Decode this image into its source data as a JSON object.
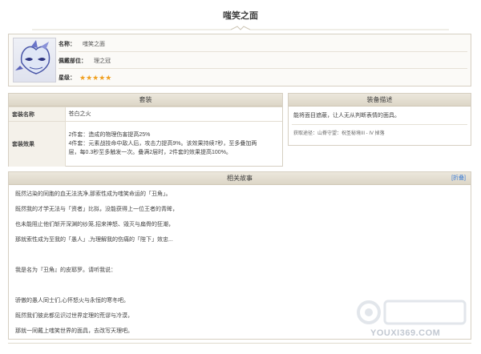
{
  "page": {
    "title": "嗤笑之面"
  },
  "item": {
    "name_label": "名称：",
    "name_value": "嗤笑之面",
    "slot_label": "佩戴部位：",
    "slot_value": "理之冠",
    "rarity_label": "星级：",
    "rarity_stars": "★★★★★",
    "rarity_count": 5,
    "star_color": "#f0a020"
  },
  "set_panel": {
    "title": "套装",
    "rows": [
      {
        "label": "套装名称",
        "lines": [
          "苍白之火"
        ]
      },
      {
        "label": "套装效果",
        "lines": [
          "2件套：造成的物理伤害提高25%",
          "4件套：元素战技命中敌人后，攻击力提高9%。该效果持续7秒，至多叠加两",
          "层，每0.3秒至多触发一次。叠满2层时，2件套的效果提高100%。"
        ]
      }
    ]
  },
  "desc_panel": {
    "title": "装备描述",
    "description": "能将面目遮蔽，让人无从判断表情的面具。",
    "source": "获取途径：山脊守望：祝圣秘境III - IV 掉落"
  },
  "story_panel": {
    "title": "相关故事",
    "fold_label": "[折叠]",
    "lines": [
      "既然沾染的同胞的血无法洗净,那索性成为嗤笑命运的「丑角」。",
      "既然我的才学无法与「资者」比拟，没能获得上一位王者的青眸，",
      "也未能阻止他们斩开深渊的纱笼,招来神怒、毁灭与扁骨的狂潮，",
      "那就索性成为至我的「愚人」,为理解我的伤痛的「陛下」效忠...",
      "",
      "我是名为『丑角』的皮耶罗。请听我说：",
      "",
      "骄傲的愚人同士们,心怀怒火与永恒的寒冬吧。",
      "既然我们彼此都见识过世界定理的荒谬与冷漠，",
      "那就一同戴上嗤笑世界的面具，去改写天理吧。"
    ]
  },
  "watermark": {
    "text": "YOUXI369.COM"
  },
  "colors": {
    "header_bg": "#e4ded1",
    "border": "#d6cfc2",
    "link": "#3a7bd5"
  }
}
